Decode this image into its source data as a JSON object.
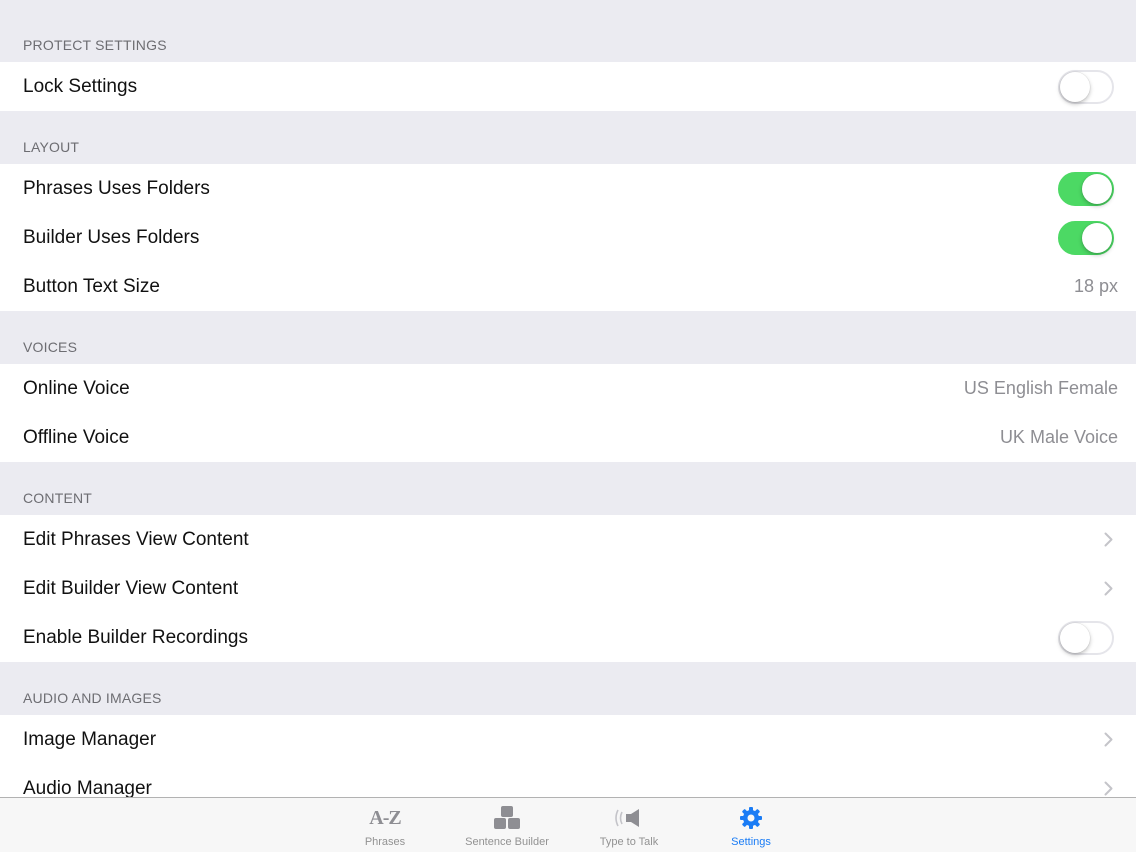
{
  "sections": [
    {
      "header": "PROTECT SETTINGS",
      "rows": [
        {
          "label": "Lock Settings",
          "toggle": "off"
        }
      ]
    },
    {
      "header": "LAYOUT",
      "rows": [
        {
          "label": "Phrases Uses Folders",
          "toggle": "on"
        },
        {
          "label": "Builder Uses Folders",
          "toggle": "on"
        },
        {
          "label": "Button Text Size",
          "value": "18 px"
        }
      ]
    },
    {
      "header": "VOICES",
      "rows": [
        {
          "label": "Online Voice",
          "value": "US English Female"
        },
        {
          "label": "Offline Voice",
          "value": "UK Male Voice"
        }
      ]
    },
    {
      "header": "CONTENT",
      "rows": [
        {
          "label": "Edit Phrases View Content"
        },
        {
          "label": "Edit Builder View Content"
        },
        {
          "label": "Enable Builder Recordings",
          "toggle": "off"
        }
      ]
    },
    {
      "header": "AUDIO AND IMAGES",
      "rows": [
        {
          "label": "Image Manager"
        },
        {
          "label": "Audio Manager"
        }
      ]
    }
  ],
  "tabbar": {
    "tabs": [
      {
        "label": "Phrases",
        "icon": "az-icon",
        "icon_text": "A-Z"
      },
      {
        "label": "Sentence Builder",
        "icon": "blocks-icon"
      },
      {
        "label": "Type to Talk",
        "icon": "speaker-icon"
      },
      {
        "label": "Settings",
        "icon": "gear-icon",
        "active": true
      }
    ]
  },
  "colors": {
    "background": "#ebebf1",
    "toggle_on": "#4cd964",
    "active_tab": "#1a7cf5",
    "secondary_text": "#8e8e93"
  }
}
